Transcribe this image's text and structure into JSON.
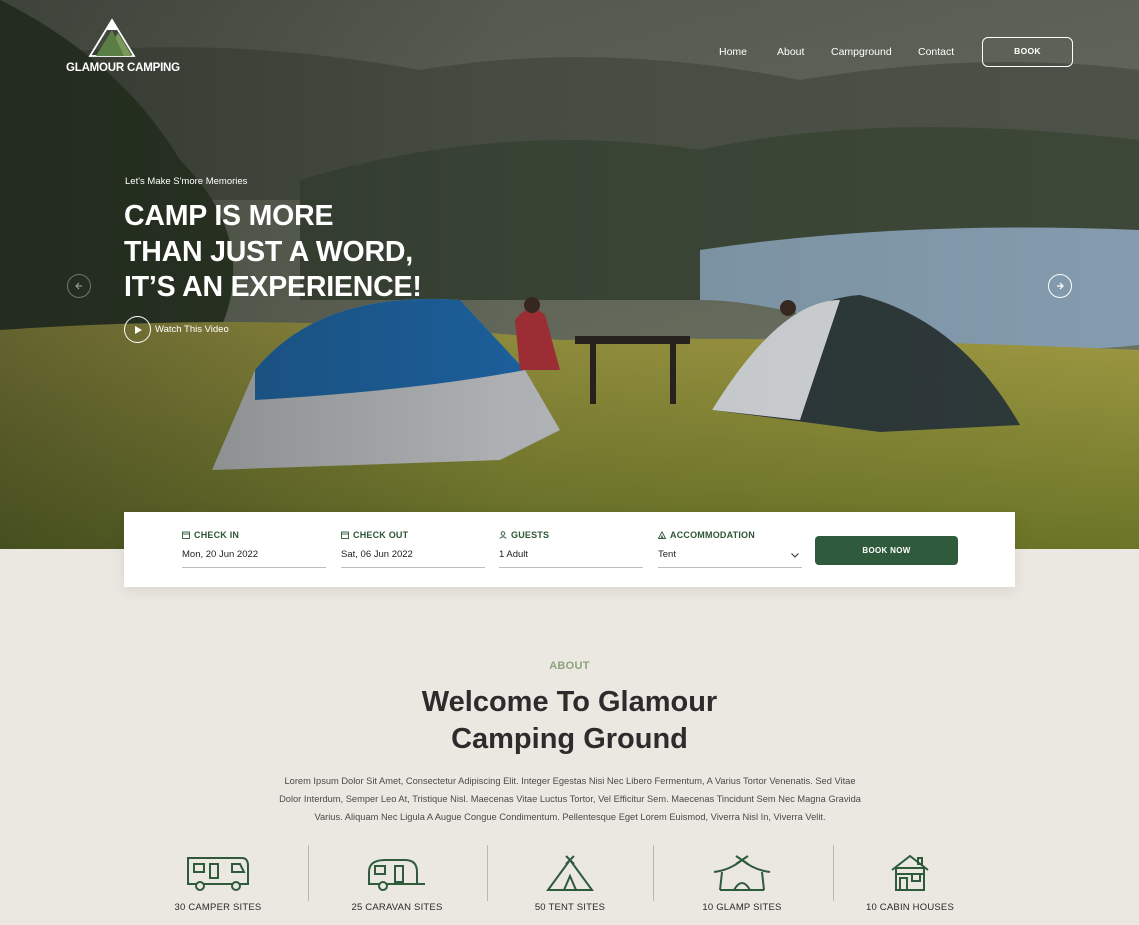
{
  "brand": {
    "name": "GLAMOUR CAMPING"
  },
  "nav": {
    "items": [
      {
        "label": "Home"
      },
      {
        "label": "About"
      },
      {
        "label": "Campground"
      },
      {
        "label": "Contact"
      }
    ],
    "book_label": "BOOK"
  },
  "hero": {
    "tagline": "Let's Make S'more Memories",
    "headline_lines": [
      "CAMP IS MORE",
      "THAN JUST A WORD,",
      "IT’S AN EXPERIENCE!"
    ],
    "watch_label": "Watch This Video",
    "prev_icon": "arrow-left-icon",
    "next_icon": "arrow-right-icon"
  },
  "booking": {
    "check_in": {
      "label": "CHECK IN",
      "value": "Mon, 20 Jun 2022"
    },
    "check_out": {
      "label": "CHECK OUT",
      "value": "Sat, 06 Jun 2022"
    },
    "guests": {
      "label": "GUESTS",
      "value": "1 Adult"
    },
    "accommodation": {
      "label": "ACCOMMODATION",
      "value": "Tent"
    },
    "submit_label": "BOOK NOW"
  },
  "about": {
    "eyebrow": "ABOUT",
    "title_lines": [
      "Welcome To Glamour",
      "Camping Ground"
    ],
    "text_lines": [
      "Lorem Ipsum Dolor Sit Amet, Consectetur Adipiscing Elit. Integer Egestas Nisi Nec Libero Fermentum, A Varius Tortor Venenatis. Sed Vitae",
      "Dolor Interdum, Semper Leo At, Tristique Nisl. Maecenas Vitae Luctus Tortor, Vel Efficitur Sem. Maecenas Tincidunt Sem Nec Magna Gravida",
      "Varius. Aliquam Nec Ligula A Augue Congue Condimentum. Pellentesque Eget Lorem Euismod, Viverra Nisl In, Viverra Velit."
    ]
  },
  "stats": [
    {
      "label": "30 CAMPER SITES",
      "icon": "camper-icon"
    },
    {
      "label": "25 CARAVAN SITES",
      "icon": "caravan-icon"
    },
    {
      "label": "50 TENT SITES",
      "icon": "tent-icon"
    },
    {
      "label": "10 GLAMP SITES",
      "icon": "glamp-icon"
    },
    {
      "label": "10 CABIN HOUSES",
      "icon": "cabin-icon"
    }
  ],
  "colors": {
    "accent": "#2f5a3c",
    "eyebrow": "#8ea27e",
    "background": "#ebe8e1"
  }
}
